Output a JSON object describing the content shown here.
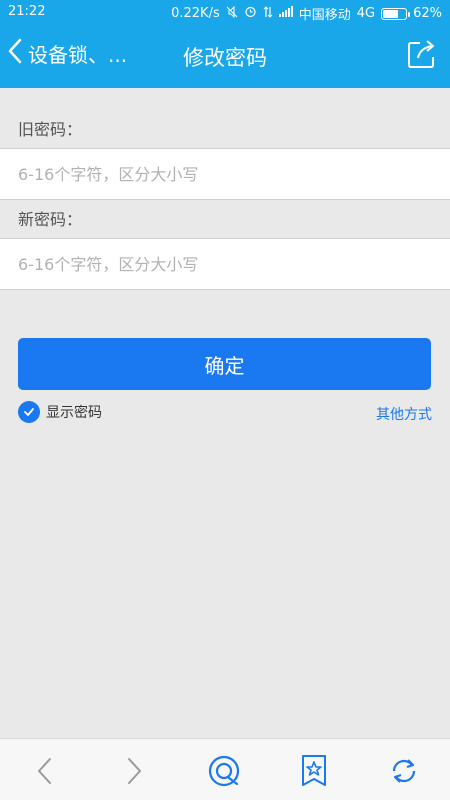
{
  "status": {
    "time": "21:22",
    "speed": "0.22K/s",
    "carrier": "中国移动",
    "network": "4G",
    "battery_percent": "62%"
  },
  "header": {
    "back_label": "设备锁、...",
    "title": "修改密码"
  },
  "form": {
    "old_label": "旧密码：",
    "old_placeholder": "6-16个字符，区分大小写",
    "new_label": "新密码：",
    "new_placeholder": "6-16个字符，区分大小写",
    "confirm_label": "确定",
    "show_password_label": "显示密码",
    "show_password_checked": true,
    "other_label": "其他方式"
  },
  "bottom_nav": [
    {
      "name": "back-arrow-icon"
    },
    {
      "name": "forward-arrow-icon"
    },
    {
      "name": "home-icon"
    },
    {
      "name": "bookmark-star-icon"
    },
    {
      "name": "refresh-icon"
    }
  ],
  "colors": {
    "primary": "#1aa7ea",
    "button": "#1a78f0",
    "background": "#e9e9e9"
  }
}
